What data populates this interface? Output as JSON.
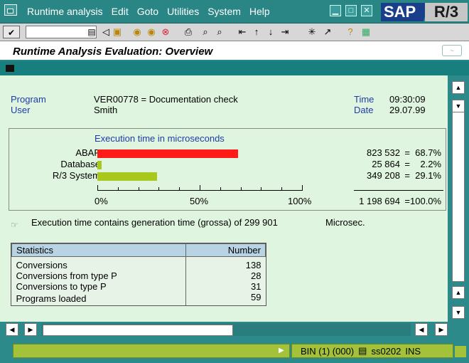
{
  "menu": {
    "items": [
      "Runtime analysis",
      "Edit",
      "Goto",
      "Utilities",
      "System",
      "Help"
    ],
    "sap_logo": "SAP",
    "r3_logo": "R/3"
  },
  "toolbar": {
    "command_value": "",
    "ok_icon": "check-icon"
  },
  "screen_title": "Runtime Analysis Evaluation: Overview",
  "header": {
    "program_label": "Program",
    "program_value": "VER00778 = Documentation check",
    "user_label": "User",
    "user_value": "Smith",
    "time_label": "Time",
    "time_value": "09:30:09",
    "date_label": "Date",
    "date_value": "29.07.99"
  },
  "chart_data": {
    "type": "bar",
    "title": "Execution time in microseconds",
    "categories": [
      "ABAP",
      "Database",
      "R/3 System"
    ],
    "values": [
      68.7,
      2.2,
      29.1
    ],
    "colors": [
      "#ff1a1a",
      "#a8c81e",
      "#a8c81e"
    ],
    "absolute": [
      "823 532",
      "25 864",
      "349 208"
    ],
    "percent_labels": [
      "68.7%",
      "2.2%",
      "29.1%"
    ],
    "xlim": [
      0,
      100
    ],
    "xticks": [
      "0%",
      "50%",
      "100%"
    ],
    "total_absolute": "1 198 694",
    "total_percent": "100.0%",
    "equals": "="
  },
  "note": {
    "text": "Execution time contains generation time (grossa) of 299 901",
    "unit": "Microsec."
  },
  "stats": {
    "header_name": "Statistics",
    "header_value": "Number",
    "rows": [
      {
        "name": "Conversions",
        "value": "138"
      },
      {
        "name": "Conversions from type P",
        "value": "28"
      },
      {
        "name": "Conversions to type P",
        "value": "31"
      },
      {
        "name": "Programs loaded",
        "value": "59"
      }
    ]
  },
  "status": {
    "message": "",
    "system": "BIN (1) (000)",
    "server": "ss0202",
    "mode": "INS"
  }
}
